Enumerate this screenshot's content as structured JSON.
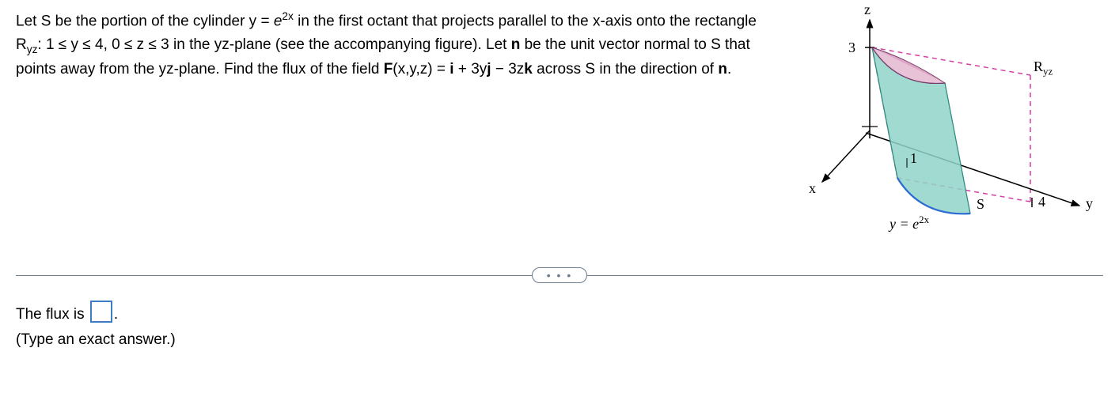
{
  "problem": {
    "p1a": "Let S be the portion of the cylinder y = ",
    "p1b": " in the first octant that projects parallel to the x-axis onto the rectangle R",
    "p1c": ": 1 ≤ y ≤ 4, 0 ≤ z ≤ 3 in the yz-plane (see the accompanying figure). Let ",
    "p1d": " be the unit vector normal to S that points away from the yz-plane. Find the flux of the field ",
    "p1e": "(x,y,z) = ",
    "p1f": " + 3y",
    "p1g": " − 3z",
    "p1h": " across S in the direction of ",
    "p1i": ".",
    "e_sym": "e",
    "exp_2x": "2x",
    "sub_yz": "yz",
    "n": "n",
    "F": "F",
    "i": "i",
    "j": "j",
    "k": "k"
  },
  "figure": {
    "z": "z",
    "x": "x",
    "y": "y",
    "val3": "3",
    "val1": "1",
    "val4": "4",
    "Ryz": "R",
    "Ryz_sub": "yz",
    "S": "S",
    "curve_eq_a": "y = ",
    "curve_eq_e": "e",
    "curve_eq_exp": "2x"
  },
  "dots": "• • •",
  "answer": {
    "line1a": "The flux is ",
    "line1b": ".",
    "line2": "(Type an exact answer.)"
  }
}
